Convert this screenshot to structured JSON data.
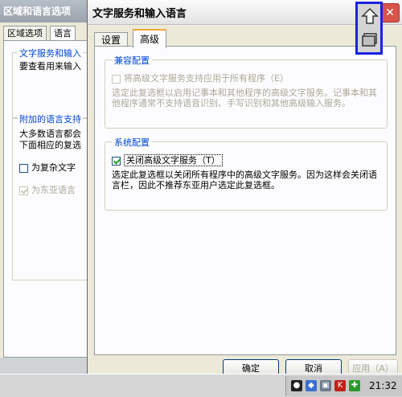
{
  "back_window": {
    "title": "区域和语言选项",
    "tabs": [
      "区域选项",
      "语言"
    ],
    "group1_label": "文字服务和输入",
    "group1_text": "要查看用来输入",
    "group2_label": "附加的语言支持",
    "group2_text1": "大多数语言都会",
    "group2_text2": "下面相应的复选",
    "checkbox1_label": "为复杂文字",
    "checkbox2_label": "为东亚语言"
  },
  "dialog": {
    "title": "文字服务和输入语言",
    "help_glyph": "?",
    "close_glyph": "✕",
    "tabs": [
      "设置",
      "高级"
    ],
    "compat": {
      "label": "兼容配置",
      "checkbox_label": "将高级文字服务支持应用于所有程序（E）",
      "description": "选定此复选框以启用记事本和其他程序的高级文字服务。记事本和其他程序通常不支持语音识别、手写识别和其他高级输入服务。"
    },
    "system": {
      "label": "系统配置",
      "checkbox_label": "关闭高级文字服务（T）",
      "description": "选定此复选框以关闭所有程序中的高级文字服务。因为这样会关闭语言栏，因此不推荐东亚用户选定此复选框。"
    },
    "buttons": {
      "ok": "确定",
      "cancel": "取消",
      "apply": "应用（A）"
    }
  },
  "taskbar": {
    "clock": "21:32",
    "tray_icons": [
      "qq-penguin-icon",
      "network-icon",
      "monitor-icon",
      "kingsoft-k-icon",
      "shield-icon"
    ]
  },
  "colors": {
    "group_label": "#0046d5",
    "highlight_box": "#1a22e0",
    "close_button": "#d6544a",
    "checkmark": "#21a121"
  }
}
